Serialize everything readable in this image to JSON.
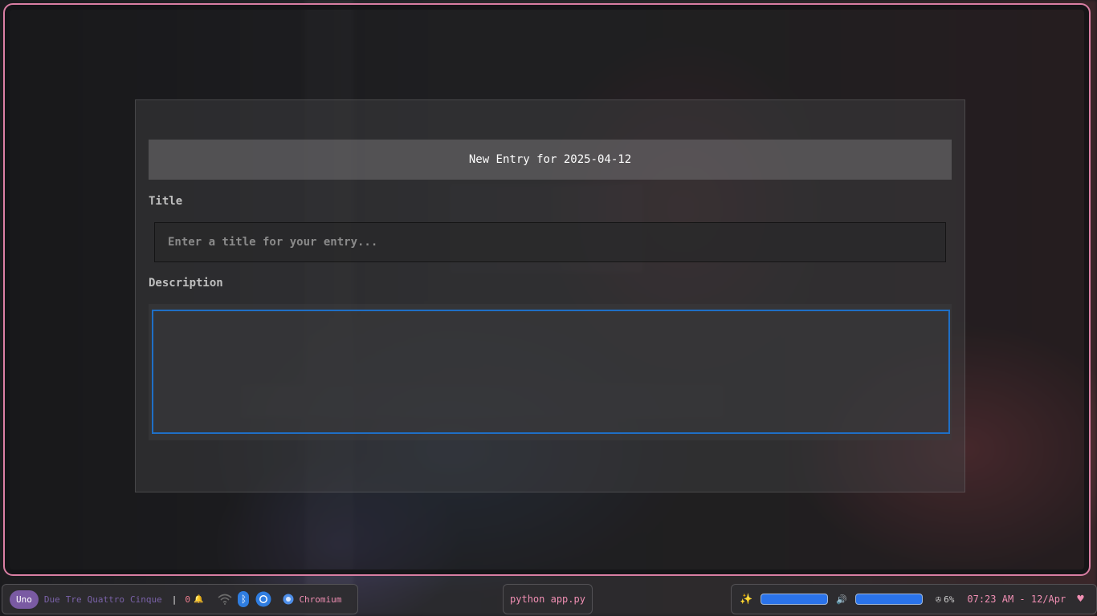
{
  "dialog": {
    "header": "New Entry for 2025-04-12",
    "title_label": "Title",
    "title_placeholder": "Enter a title for your entry...",
    "title_value": "",
    "description_label": "Description",
    "description_value": ""
  },
  "taskbar": {
    "workspaces": [
      "Uno",
      "Due",
      "Tre",
      "Quattro",
      "Cinque"
    ],
    "active_workspace": "Uno",
    "separator": "|",
    "notification_count": "0",
    "bell_glyph": "🔔",
    "bluetooth_glyph": "ᛒ",
    "browser_label": "Chromium",
    "active_window": "python app.py",
    "sparkle_glyph": "✨",
    "volume_glyph": "🔊",
    "cpu_label": "6%",
    "cpu_glyph": "✇",
    "clock": "07:23 AM - 12/Apr",
    "heart_glyph": "♥",
    "brightness_level_pct": 100,
    "volume_level_pct": 100
  },
  "colors": {
    "frame_border": "#d97ea3",
    "focus_border": "#1f6fc6",
    "accent_pink": "#f08fb3",
    "workspace_active_bg": "#7a5aa3",
    "level_bar": "#2a73ea"
  },
  "icons": [
    "wifi-icon",
    "bluetooth-icon",
    "chromium-icon",
    "bell-icon",
    "sparkle-icon",
    "volume-icon",
    "cpu-icon",
    "heart-icon"
  ]
}
